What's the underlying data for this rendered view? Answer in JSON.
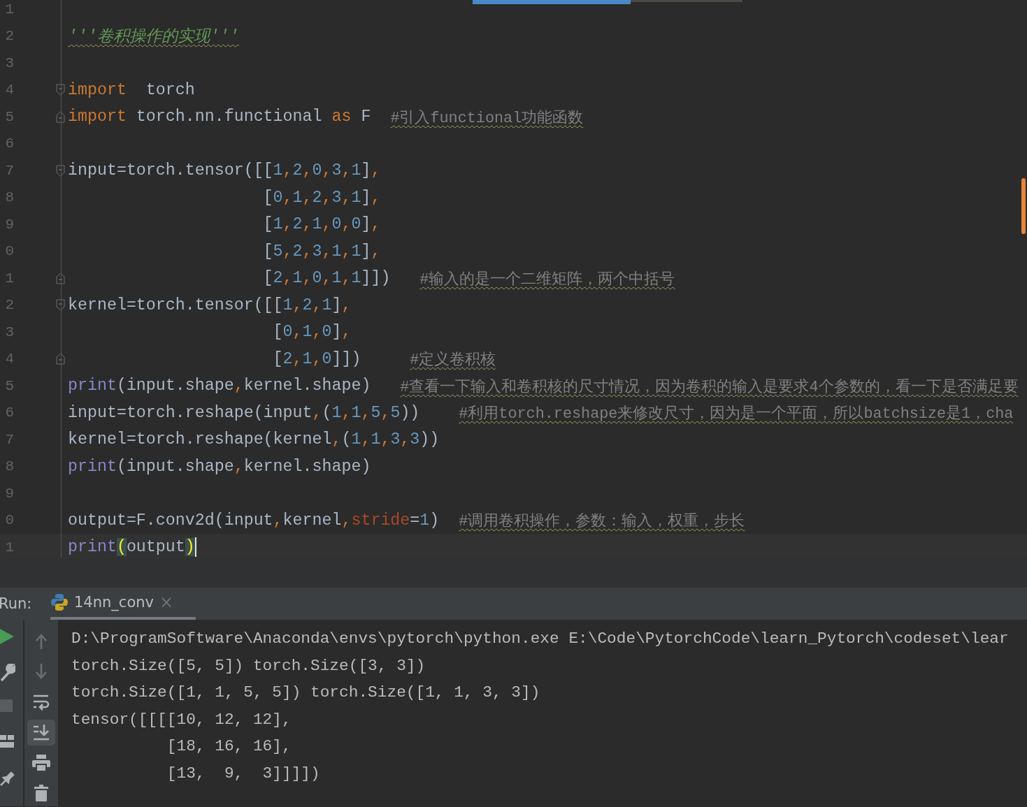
{
  "editor": {
    "lines": [
      {
        "number": "1",
        "current": false
      },
      {
        "number": "2",
        "current": false,
        "tokens": [
          {
            "kind": "doc",
            "text": "'''卷积操作的实现'''"
          }
        ]
      },
      {
        "number": "3",
        "current": false
      },
      {
        "number": "4",
        "current": false,
        "kind": "fold-start",
        "tokens": [
          {
            "kind": "kw",
            "text": "import"
          },
          {
            "kind": "plain",
            "text": "  torch"
          }
        ]
      },
      {
        "number": "5",
        "current": false,
        "kind": "fold-end",
        "tokens": [
          {
            "kind": "kw",
            "text": "import"
          },
          {
            "kind": "plain",
            "text": " torch.nn.functional "
          },
          {
            "kind": "kw",
            "text": "as"
          },
          {
            "kind": "plain",
            "text": " F  "
          },
          {
            "kind": "comment",
            "text": "#引入functional功能函数"
          }
        ]
      },
      {
        "number": "6",
        "current": false
      },
      {
        "number": "7",
        "current": false,
        "kind": "fold-start",
        "tokens": [
          {
            "kind": "plain",
            "text": "input=torch.tensor([["
          },
          {
            "kind": "num",
            "text": "1"
          },
          {
            "kind": "comma",
            "text": ","
          },
          {
            "kind": "num",
            "text": "2"
          },
          {
            "kind": "comma",
            "text": ","
          },
          {
            "kind": "num",
            "text": "0"
          },
          {
            "kind": "comma",
            "text": ","
          },
          {
            "kind": "num",
            "text": "3"
          },
          {
            "kind": "comma",
            "text": ","
          },
          {
            "kind": "num",
            "text": "1"
          },
          {
            "kind": "plain",
            "text": "]"
          },
          {
            "kind": "comma",
            "text": ","
          }
        ]
      },
      {
        "number": "8",
        "current": false,
        "tokens": [
          {
            "kind": "plain",
            "text": "                    ["
          },
          {
            "kind": "num",
            "text": "0"
          },
          {
            "kind": "comma",
            "text": ","
          },
          {
            "kind": "num",
            "text": "1"
          },
          {
            "kind": "comma",
            "text": ","
          },
          {
            "kind": "num",
            "text": "2"
          },
          {
            "kind": "comma",
            "text": ","
          },
          {
            "kind": "num",
            "text": "3"
          },
          {
            "kind": "comma",
            "text": ","
          },
          {
            "kind": "num",
            "text": "1"
          },
          {
            "kind": "plain",
            "text": "]"
          },
          {
            "kind": "comma",
            "text": ","
          }
        ]
      },
      {
        "number": "9",
        "current": false,
        "tokens": [
          {
            "kind": "plain",
            "text": "                    ["
          },
          {
            "kind": "num",
            "text": "1"
          },
          {
            "kind": "comma",
            "text": ","
          },
          {
            "kind": "num",
            "text": "2"
          },
          {
            "kind": "comma",
            "text": ","
          },
          {
            "kind": "num",
            "text": "1"
          },
          {
            "kind": "comma",
            "text": ","
          },
          {
            "kind": "num",
            "text": "0"
          },
          {
            "kind": "comma",
            "text": ","
          },
          {
            "kind": "num",
            "text": "0"
          },
          {
            "kind": "plain",
            "text": "]"
          },
          {
            "kind": "comma",
            "text": ","
          }
        ]
      },
      {
        "number": "0",
        "current": false,
        "tokens": [
          {
            "kind": "plain",
            "text": "                    ["
          },
          {
            "kind": "num",
            "text": "5"
          },
          {
            "kind": "comma",
            "text": ","
          },
          {
            "kind": "num",
            "text": "2"
          },
          {
            "kind": "comma",
            "text": ","
          },
          {
            "kind": "num",
            "text": "3"
          },
          {
            "kind": "comma",
            "text": ","
          },
          {
            "kind": "num",
            "text": "1"
          },
          {
            "kind": "comma",
            "text": ","
          },
          {
            "kind": "num",
            "text": "1"
          },
          {
            "kind": "plain",
            "text": "]"
          },
          {
            "kind": "comma",
            "text": ","
          }
        ]
      },
      {
        "number": "1",
        "current": false,
        "kind": "fold-end",
        "tokens": [
          {
            "kind": "plain",
            "text": "                    ["
          },
          {
            "kind": "num",
            "text": "2"
          },
          {
            "kind": "comma",
            "text": ","
          },
          {
            "kind": "num",
            "text": "1"
          },
          {
            "kind": "comma",
            "text": ","
          },
          {
            "kind": "num",
            "text": "0"
          },
          {
            "kind": "comma",
            "text": ","
          },
          {
            "kind": "num",
            "text": "1"
          },
          {
            "kind": "comma",
            "text": ","
          },
          {
            "kind": "num",
            "text": "1"
          },
          {
            "kind": "plain",
            "text": "]])   "
          },
          {
            "kind": "comment",
            "text": "#输入的是一个二维矩阵，两个中括号"
          }
        ]
      },
      {
        "number": "2",
        "current": false,
        "kind": "fold-start",
        "tokens": [
          {
            "kind": "plain",
            "text": "kernel=torch.tensor([["
          },
          {
            "kind": "num",
            "text": "1"
          },
          {
            "kind": "comma",
            "text": ","
          },
          {
            "kind": "num",
            "text": "2"
          },
          {
            "kind": "comma",
            "text": ","
          },
          {
            "kind": "num",
            "text": "1"
          },
          {
            "kind": "plain",
            "text": "]"
          },
          {
            "kind": "comma",
            "text": ","
          }
        ]
      },
      {
        "number": "3",
        "current": false,
        "tokens": [
          {
            "kind": "plain",
            "text": "                     ["
          },
          {
            "kind": "num",
            "text": "0"
          },
          {
            "kind": "comma",
            "text": ","
          },
          {
            "kind": "num",
            "text": "1"
          },
          {
            "kind": "comma",
            "text": ","
          },
          {
            "kind": "num",
            "text": "0"
          },
          {
            "kind": "plain",
            "text": "]"
          },
          {
            "kind": "comma",
            "text": ","
          }
        ]
      },
      {
        "number": "4",
        "current": false,
        "kind": "fold-end",
        "tokens": [
          {
            "kind": "plain",
            "text": "                     ["
          },
          {
            "kind": "num",
            "text": "2"
          },
          {
            "kind": "comma",
            "text": ","
          },
          {
            "kind": "num",
            "text": "1"
          },
          {
            "kind": "comma",
            "text": ","
          },
          {
            "kind": "num",
            "text": "0"
          },
          {
            "kind": "plain",
            "text": "]])     "
          },
          {
            "kind": "comment",
            "text": "#定义卷积核"
          }
        ]
      },
      {
        "number": "5",
        "current": false,
        "tokens": [
          {
            "kind": "builtin",
            "text": "print"
          },
          {
            "kind": "plain",
            "text": "(input.shape"
          },
          {
            "kind": "comma",
            "text": ","
          },
          {
            "kind": "plain",
            "text": "kernel.shape)   "
          },
          {
            "kind": "comment",
            "text": "#查看一下输入和卷积核的尺寸情况，因为卷积的输入是要求4个参数的，看一下是否满足要"
          }
        ]
      },
      {
        "number": "6",
        "current": false,
        "tokens": [
          {
            "kind": "plain",
            "text": "input=torch.reshape(input"
          },
          {
            "kind": "comma",
            "text": ","
          },
          {
            "kind": "plain",
            "text": "("
          },
          {
            "kind": "num",
            "text": "1"
          },
          {
            "kind": "comma",
            "text": ","
          },
          {
            "kind": "num",
            "text": "1"
          },
          {
            "kind": "comma",
            "text": ","
          },
          {
            "kind": "num",
            "text": "5"
          },
          {
            "kind": "comma",
            "text": ","
          },
          {
            "kind": "num",
            "text": "5"
          },
          {
            "kind": "plain",
            "text": "))    "
          },
          {
            "kind": "comment",
            "text": "#利用torch.reshape来修改尺寸，因为是一个平面，所以batchsize是1，cha"
          }
        ]
      },
      {
        "number": "7",
        "current": false,
        "tokens": [
          {
            "kind": "plain",
            "text": "kernel=torch.reshape(kernel"
          },
          {
            "kind": "comma",
            "text": ","
          },
          {
            "kind": "plain",
            "text": "("
          },
          {
            "kind": "num",
            "text": "1"
          },
          {
            "kind": "comma",
            "text": ","
          },
          {
            "kind": "num",
            "text": "1"
          },
          {
            "kind": "comma",
            "text": ","
          },
          {
            "kind": "num",
            "text": "3"
          },
          {
            "kind": "comma",
            "text": ","
          },
          {
            "kind": "num",
            "text": "3"
          },
          {
            "kind": "plain",
            "text": "))"
          }
        ]
      },
      {
        "number": "8",
        "current": false,
        "tokens": [
          {
            "kind": "builtin",
            "text": "print"
          },
          {
            "kind": "plain",
            "text": "(input.shape"
          },
          {
            "kind": "comma",
            "text": ","
          },
          {
            "kind": "plain",
            "text": "kernel.shape)"
          }
        ]
      },
      {
        "number": "9",
        "current": false
      },
      {
        "number": "0",
        "current": false,
        "tokens": [
          {
            "kind": "plain",
            "text": "output=F.conv2d(input"
          },
          {
            "kind": "comma",
            "text": ","
          },
          {
            "kind": "plain",
            "text": "kernel"
          },
          {
            "kind": "comma",
            "text": ","
          },
          {
            "kind": "param",
            "text": "stride"
          },
          {
            "kind": "plain",
            "text": "="
          },
          {
            "kind": "num",
            "text": "1"
          },
          {
            "kind": "plain",
            "text": ")  "
          },
          {
            "kind": "comment",
            "text": "#调用卷积操作，参数：输入，权重，步长"
          }
        ]
      },
      {
        "number": "1",
        "current": true,
        "tokens": [
          {
            "kind": "builtin",
            "text": "print"
          },
          {
            "kind": "match",
            "text": "("
          },
          {
            "kind": "plain",
            "text": "output"
          },
          {
            "kind": "match",
            "text": ")"
          }
        ]
      }
    ]
  },
  "run_panel": {
    "label": "Run:",
    "tabs": [
      {
        "title": "14nn_conv",
        "close": "×",
        "selected": true
      }
    ],
    "toolbar_left": [
      {
        "kind": "run"
      },
      {
        "kind": "wrench"
      },
      {
        "kind": "stop"
      },
      {
        "kind": "layout"
      },
      {
        "kind": "pin"
      }
    ],
    "toolbar": [
      {
        "kind": "up",
        "selected": false
      },
      {
        "kind": "down",
        "selected": false
      },
      {
        "kind": "wrap",
        "selected": false
      },
      {
        "kind": "scroll-end",
        "selected": true
      },
      {
        "kind": "print",
        "selected": false
      },
      {
        "kind": "trash",
        "selected": false
      }
    ],
    "console": [
      "D:\\ProgramSoftware\\Anaconda\\envs\\pytorch\\python.exe E:\\Code\\PytorchCode\\learn_Pytorch\\codeset\\lear",
      "torch.Size([5, 5]) torch.Size([3, 3])",
      "torch.Size([1, 1, 5, 5]) torch.Size([1, 1, 3, 3])",
      "tensor([[[[10, 12, 12],",
      "          [18, 16, 16],",
      "          [13,  9,  3]]]])"
    ]
  }
}
